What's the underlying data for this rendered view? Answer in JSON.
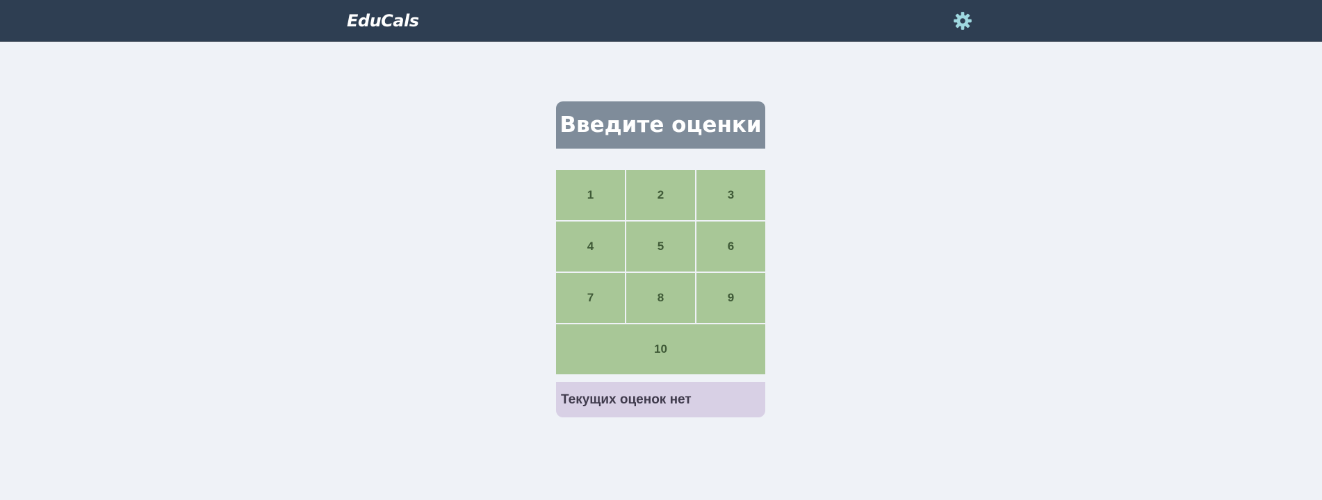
{
  "app": {
    "logo_text": "EduCals",
    "settings_icon": "gear-icon",
    "icon_color": "#9fd8e0"
  },
  "panel": {
    "title": "Введите оценки",
    "keys": [
      "1",
      "2",
      "3",
      "4",
      "5",
      "6",
      "7",
      "8",
      "9",
      "10"
    ],
    "status_text": "Текущих оценок нет"
  },
  "colors": {
    "topbar": "#2e3e52",
    "background": "#eff2f7",
    "header": "#7f8c9a",
    "key": "#a8c797",
    "key_text": "#3f5a37",
    "status": "#d8d0e5"
  }
}
